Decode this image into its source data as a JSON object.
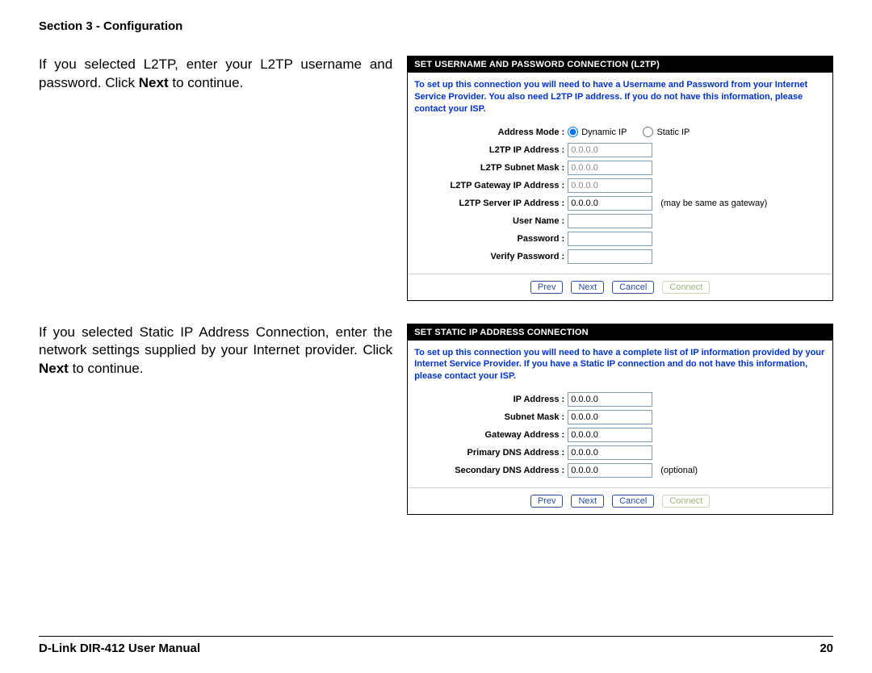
{
  "header": {
    "section": "Section 3 - Configuration"
  },
  "block1": {
    "text_pre": "If you selected L2TP, enter your L2TP username and password. Click ",
    "text_bold": "Next",
    "text_post": " to continue.",
    "panel": {
      "title": "SET USERNAME AND PASSWORD CONNECTION (L2TP)",
      "desc": "To set up this connection you will need to have a Username and Password from your Internet Service Provider. You also need L2TP IP address. If you do not have this information, please contact your ISP.",
      "rows": {
        "address_mode_label": "Address Mode  :",
        "dynamic_ip": "Dynamic IP",
        "static_ip": "Static IP",
        "l2tp_ip_label": "L2TP IP Address  :",
        "l2tp_ip_value": "0.0.0.0",
        "subnet_label": "L2TP Subnet Mask  :",
        "subnet_value": "0.0.0.0",
        "gateway_label": "L2TP Gateway IP Address  :",
        "gateway_value": "0.0.0.0",
        "server_label": "L2TP Server IP Address  :",
        "server_value": "0.0.0.0",
        "server_hint": "(may be same as gateway)",
        "user_label": "User Name  :",
        "pass_label": "Password  :",
        "verify_label": "Verify Password  :"
      },
      "buttons": {
        "prev": "Prev",
        "next": "Next",
        "cancel": "Cancel",
        "connect": "Connect"
      }
    }
  },
  "block2": {
    "text_pre": "If you selected Static IP Address Connection, enter the network settings supplied by your Internet provider. Click ",
    "text_bold": "Next",
    "text_post": " to continue.",
    "panel": {
      "title": "SET STATIC IP ADDRESS CONNECTION",
      "desc": "To set up this connection you will need to have a complete list of IP information provided by your Internet Service Provider. If you have a Static IP connection and do not have this information, please contact your ISP.",
      "rows": {
        "ip_label": "IP Address  :",
        "ip_value": "0.0.0.0",
        "subnet_label": "Subnet Mask  :",
        "subnet_value": "0.0.0.0",
        "gateway_label": "Gateway Address  :",
        "gateway_value": "0.0.0.0",
        "pdns_label": "Primary DNS Address  :",
        "pdns_value": "0.0.0.0",
        "sdns_label": "Secondary DNS Address  :",
        "sdns_value": "0.0.0.0",
        "sdns_hint": "(optional)"
      },
      "buttons": {
        "prev": "Prev",
        "next": "Next",
        "cancel": "Cancel",
        "connect": "Connect"
      }
    }
  },
  "footer": {
    "left": "D-Link DIR-412 User Manual",
    "right": "20"
  }
}
